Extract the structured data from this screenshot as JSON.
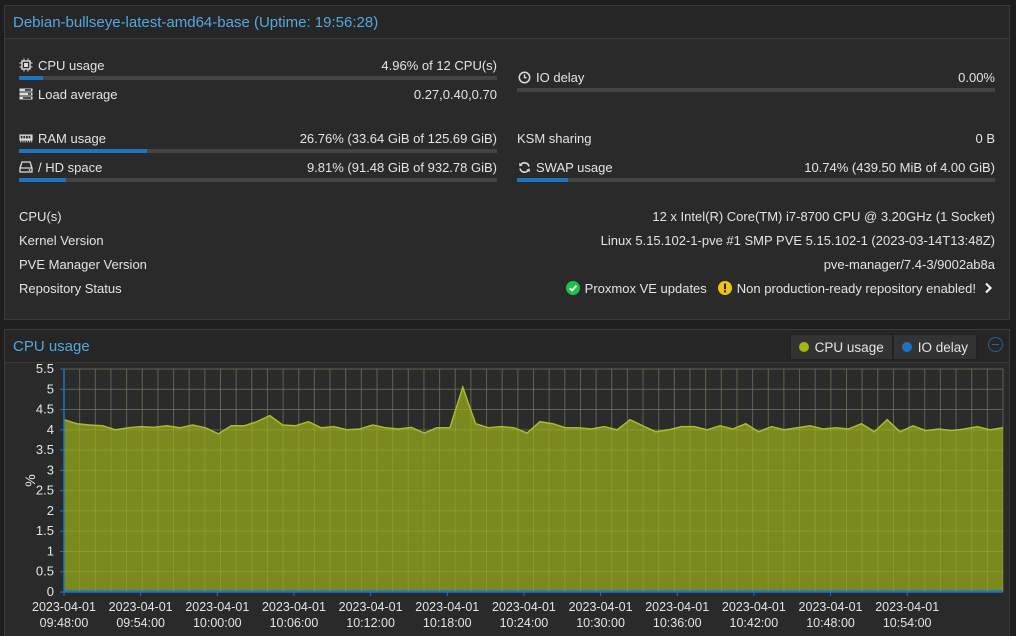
{
  "status": {
    "title": "Debian-bullseye-latest-amd64-base (Uptime: 19:56:28)",
    "cpu": {
      "label": "CPU usage",
      "value": "4.96% of 12 CPU(s)",
      "fraction": 0.0496,
      "icon": "cpu-chip-icon"
    },
    "io_delay": {
      "label": "IO delay",
      "value": "0.00%",
      "fraction": 0.0,
      "icon": "clock-icon"
    },
    "load": {
      "label": "Load average",
      "value": "0.27,0.40,0.70",
      "icon": "tasks-icon"
    },
    "ram": {
      "label": "RAM usage",
      "value": "26.76% (33.64 GiB of 125.69 GiB)",
      "fraction": 0.2676,
      "icon": "memory-icon"
    },
    "ksm": {
      "label": "KSM sharing",
      "value": "0 B"
    },
    "hd": {
      "label": "/ HD space",
      "value": "9.81% (91.48 GiB of 932.78 GiB)",
      "fraction": 0.0981,
      "icon": "hdd-icon"
    },
    "swap": {
      "label": "SWAP usage",
      "value": "10.74% (439.50 MiB of 4.00 GiB)",
      "fraction": 0.1074,
      "icon": "refresh-icon"
    },
    "cpus": {
      "label": "CPU(s)",
      "value": "12 x Intel(R) Core(TM) i7-8700 CPU @ 3.20GHz (1 Socket)"
    },
    "kernel": {
      "label": "Kernel Version",
      "value": "Linux 5.15.102-1-pve #1 SMP PVE 5.15.102-1 (2023-03-14T13:48Z)"
    },
    "pve": {
      "label": "PVE Manager Version",
      "value": "pve-manager/7.4-3/9002ab8a"
    },
    "repo": {
      "label": "Repository Status",
      "updates": "Proxmox VE updates",
      "warning": "Non production-ready repository enabled!"
    }
  },
  "chart_panel": {
    "title": "CPU usage",
    "legend": [
      {
        "label": "CPU usage",
        "color": "#a2b513"
      },
      {
        "label": "IO delay",
        "color": "#1f74c2"
      }
    ]
  },
  "chart_data": {
    "type": "area",
    "ylabel": "%",
    "ylim": [
      0,
      5.5
    ],
    "yticks": [
      "0",
      "0.5",
      "1",
      "1.5",
      "2",
      "2.5",
      "3",
      "3.5",
      "4",
      "4.5",
      "5",
      "5.5"
    ],
    "xticks": [
      {
        "date": "2023-04-01",
        "time": "09:48:00"
      },
      {
        "date": "2023-04-01",
        "time": "09:54:00"
      },
      {
        "date": "2023-04-01",
        "time": "10:00:00"
      },
      {
        "date": "2023-04-01",
        "time": "10:06:00"
      },
      {
        "date": "2023-04-01",
        "time": "10:12:00"
      },
      {
        "date": "2023-04-01",
        "time": "10:18:00"
      },
      {
        "date": "2023-04-01",
        "time": "10:24:00"
      },
      {
        "date": "2023-04-01",
        "time": "10:30:00"
      },
      {
        "date": "2023-04-01",
        "time": "10:36:00"
      },
      {
        "date": "2023-04-01",
        "time": "10:42:00"
      },
      {
        "date": "2023-04-01",
        "time": "10:48:00"
      },
      {
        "date": "2023-04-01",
        "time": "10:54:00"
      }
    ],
    "series": [
      {
        "name": "CPU usage",
        "color": "#8a9a1c",
        "values": [
          4.25,
          4.15,
          4.12,
          4.1,
          4.0,
          4.05,
          4.08,
          4.06,
          4.1,
          4.05,
          4.12,
          4.05,
          3.9,
          4.1,
          4.1,
          4.2,
          4.35,
          4.12,
          4.1,
          4.2,
          4.05,
          4.08,
          4.0,
          4.02,
          4.12,
          4.05,
          4.02,
          4.06,
          3.92,
          4.05,
          4.05,
          5.05,
          4.15,
          4.05,
          4.08,
          4.05,
          3.92,
          4.2,
          4.15,
          4.05,
          4.05,
          4.02,
          4.08,
          4.0,
          4.25,
          4.1,
          3.95,
          4.0,
          4.08,
          4.08,
          4.0,
          4.1,
          4.02,
          4.15,
          3.95,
          4.08,
          4.0,
          4.05,
          4.1,
          4.02,
          4.05,
          4.02,
          4.15,
          3.95,
          4.25,
          3.95,
          4.1,
          3.98,
          4.02,
          3.98,
          4.02,
          4.08,
          4.0,
          4.05
        ]
      },
      {
        "name": "IO delay",
        "color": "#1f74c2",
        "values": [
          0.02,
          0.02,
          0.02,
          0.02,
          0.02,
          0.02,
          0.02,
          0.02,
          0.02,
          0.02,
          0.02,
          0.02,
          0.02,
          0.02,
          0.02,
          0.02,
          0.02,
          0.02,
          0.02,
          0.02,
          0.02,
          0.02,
          0.02,
          0.02,
          0.02,
          0.02,
          0.02,
          0.02,
          0.02,
          0.02,
          0.02,
          0.02,
          0.02,
          0.02,
          0.02,
          0.02,
          0.02,
          0.02,
          0.02,
          0.02,
          0.02,
          0.02,
          0.02,
          0.02,
          0.02,
          0.02,
          0.02,
          0.02,
          0.02,
          0.02,
          0.02,
          0.02,
          0.02,
          0.02,
          0.02,
          0.02,
          0.02,
          0.02,
          0.02,
          0.02,
          0.02,
          0.02,
          0.02,
          0.02,
          0.02,
          0.02,
          0.02,
          0.02,
          0.02,
          0.02,
          0.02,
          0.02,
          0.02,
          0.02
        ]
      }
    ],
    "grid": true,
    "legend_position": "top-right"
  }
}
